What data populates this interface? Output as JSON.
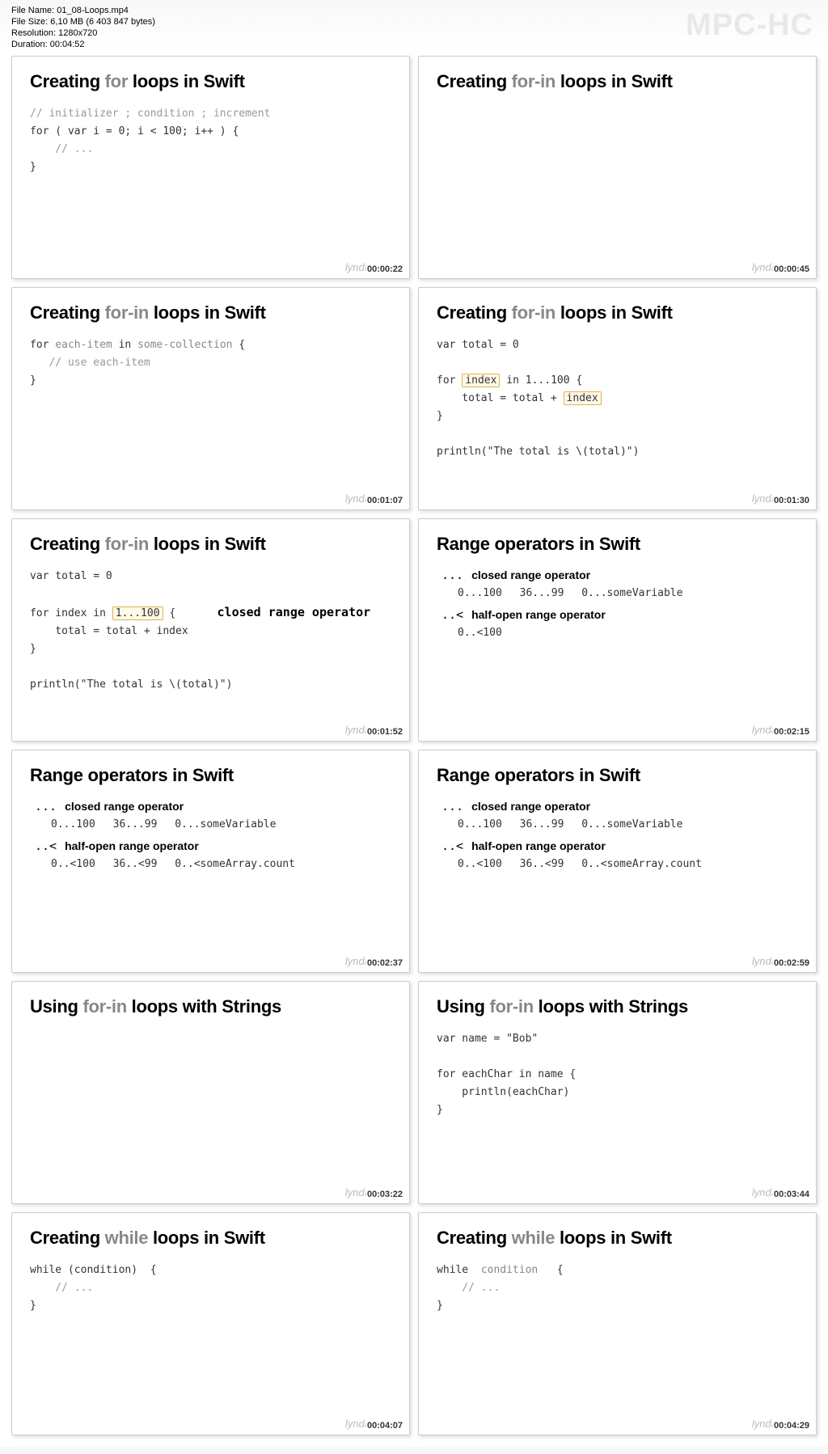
{
  "header": {
    "file_name_label": "File Name: ",
    "file_name": "01_08-Loops.mp4",
    "file_size_label": "File Size: ",
    "file_size": "6,10 MB (6 403 847 bytes)",
    "resolution_label": "Resolution: ",
    "resolution": "1280x720",
    "duration_label": "Duration: ",
    "duration": "00:04:52",
    "logo": "MPC-HC"
  },
  "watermark": "lynda",
  "slides": [
    {
      "title_pre": "Creating ",
      "title_kw": "for",
      "title_post": " loops in Swift",
      "timestamp": "00:00:22",
      "code_lines": [
        {
          "text": "// initializer ; condition ; increment",
          "cls": "comment"
        },
        {
          "text": "for ( var i = 0; i < 100; i++ ) {"
        },
        {
          "text": "    // ...",
          "cls": "comment"
        },
        {
          "text": "}"
        }
      ]
    },
    {
      "title_pre": "Creating ",
      "title_kw": "for-in",
      "title_post": " loops in Swift",
      "timestamp": "00:00:45",
      "code_lines": []
    },
    {
      "title_pre": "Creating ",
      "title_kw": "for-in",
      "title_post": " loops in Swift",
      "timestamp": "00:01:07",
      "code_lines": [
        {
          "html": "for <span class='kw'>each-item</span> in <span class='kw'>some-collection</span> {"
        },
        {
          "text": "   // use each-item",
          "cls": "comment"
        },
        {
          "text": "}"
        }
      ]
    },
    {
      "title_pre": "Creating ",
      "title_kw": "for-in",
      "title_post": " loops in Swift",
      "timestamp": "00:01:30",
      "code_lines": [
        {
          "text": "var total = 0"
        },
        {
          "text": ""
        },
        {
          "html": "for <span class='hl'>index</span> in 1...100 {"
        },
        {
          "html": "    total = total + <span class='hl'>index</span>"
        },
        {
          "text": "}"
        },
        {
          "text": ""
        },
        {
          "text": "println(\"The total is \\(total)\")"
        }
      ]
    },
    {
      "title_pre": "Creating ",
      "title_kw": "for-in",
      "title_post": " loops in Swift",
      "timestamp": "00:01:52",
      "code_lines": [
        {
          "text": "var total = 0"
        },
        {
          "text": ""
        },
        {
          "html": "for index in <span class='hl'>1...100</span> {    <span class='annotation'>closed range operator</span>"
        },
        {
          "text": "    total = total + index"
        },
        {
          "text": "}"
        },
        {
          "text": ""
        },
        {
          "text": "println(\"The total is \\(total)\")"
        }
      ]
    },
    {
      "title_pre": "Range operators in Swift",
      "title_kw": "",
      "title_post": "",
      "timestamp": "00:02:15",
      "range_blocks": [
        {
          "op": "...",
          "label": "closed range operator",
          "examples": "0...100   36...99   0...someVariable"
        },
        {
          "op": "..<",
          "label": "half-open range operator",
          "examples": "0..<100"
        }
      ]
    },
    {
      "title_pre": "Range operators in Swift",
      "title_kw": "",
      "title_post": "",
      "timestamp": "00:02:37",
      "range_blocks": [
        {
          "op": "...",
          "label": "closed range operator",
          "examples": "0...100   36...99   0...someVariable"
        },
        {
          "op": "..<",
          "label": "half-open range operator",
          "examples": "0..<100   36..<99   0..<someArray.count"
        }
      ]
    },
    {
      "title_pre": "Range operators in Swift",
      "title_kw": "",
      "title_post": "",
      "timestamp": "00:02:59",
      "range_blocks": [
        {
          "op": "...",
          "label": "closed range operator",
          "examples": "0...100   36...99   0...someVariable"
        },
        {
          "op": "..<",
          "label": "half-open range operator",
          "examples": "0..<100   36..<99   0..<someArray.count"
        }
      ]
    },
    {
      "title_pre": "Using ",
      "title_kw": "for-in",
      "title_post": " loops with Strings",
      "timestamp": "00:03:22",
      "code_lines": []
    },
    {
      "title_pre": "Using ",
      "title_kw": "for-in",
      "title_post": " loops with Strings",
      "timestamp": "00:03:44",
      "code_lines": [
        {
          "text": "var name = \"Bob\""
        },
        {
          "text": ""
        },
        {
          "text": "for eachChar in name {"
        },
        {
          "text": "    println(eachChar)"
        },
        {
          "text": "}"
        }
      ]
    },
    {
      "title_pre": "Creating ",
      "title_kw": "while",
      "title_post": " loops in Swift",
      "timestamp": "00:04:07",
      "code_lines": [
        {
          "text": "while (condition)  {"
        },
        {
          "text": "    // ...",
          "cls": "comment"
        },
        {
          "text": "}"
        }
      ]
    },
    {
      "title_pre": "Creating ",
      "title_kw": "while",
      "title_post": " loops in Swift",
      "timestamp": "00:04:29",
      "code_lines": [
        {
          "html": "while  <span class='kw'>condition</span>   {"
        },
        {
          "text": "    // ...",
          "cls": "comment"
        },
        {
          "text": "}"
        }
      ]
    }
  ]
}
